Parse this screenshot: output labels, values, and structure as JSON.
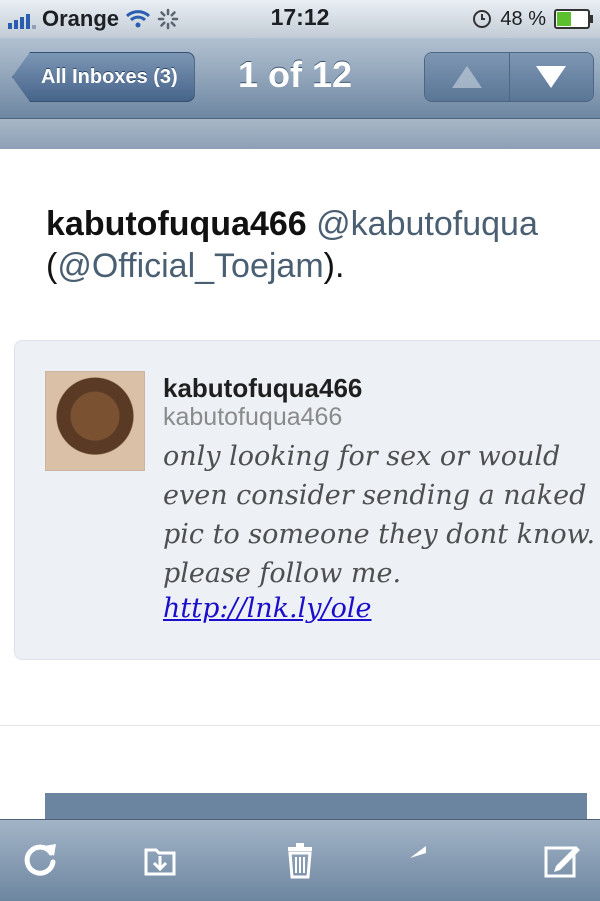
{
  "status_bar": {
    "carrier": "Orange",
    "time": "17:12",
    "battery_percent": "48 %",
    "battery_level": 0.48
  },
  "nav": {
    "back_label": "All Inboxes (3)",
    "title": "1 of 12"
  },
  "message": {
    "sender_name": "kabutofuqua466",
    "sender_handle": "@kabutofuqua",
    "mention_open": "(",
    "mention": "@Official_Toejam",
    "mention_close": ")."
  },
  "tweet": {
    "display_name": "kabutofuqua466",
    "username": "kabutofuqua466",
    "text": "only looking for sex or would even consider sending a naked pic to someone they dont know. please follow me.",
    "link": "http://lnk.ly/ole"
  },
  "icons": {
    "refresh": "refresh-icon",
    "move": "move-to-folder-icon",
    "trash": "trash-icon",
    "reply": "reply-icon",
    "compose": "compose-icon",
    "up": "up-arrow-icon",
    "down": "down-arrow-icon"
  }
}
